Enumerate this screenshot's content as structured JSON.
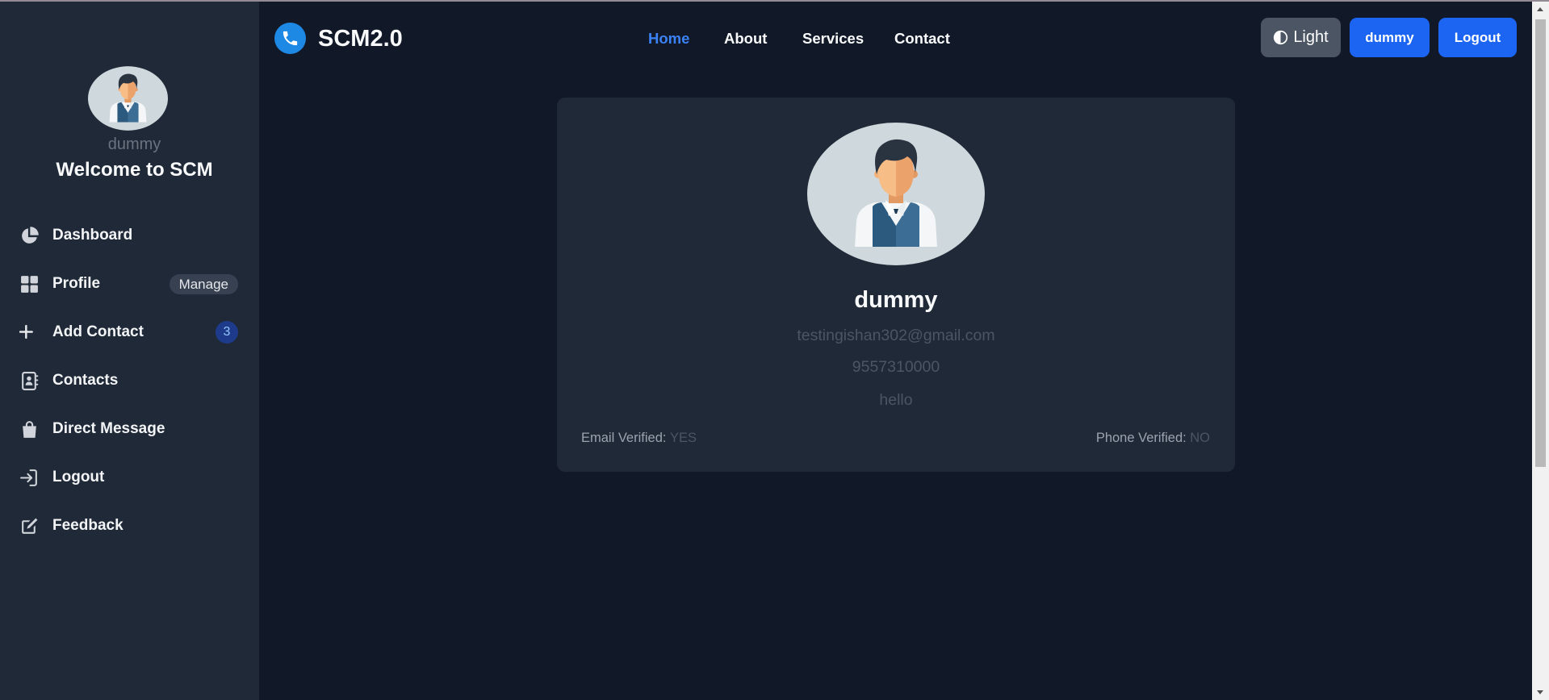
{
  "app": {
    "logo_icon": "phone-icon",
    "title": "SCM2.0"
  },
  "nav": {
    "links": [
      {
        "label": "Home",
        "active": true
      },
      {
        "label": "About",
        "active": false
      },
      {
        "label": "Services",
        "active": false
      },
      {
        "label": "Contact",
        "active": false
      }
    ],
    "theme_toggle": {
      "icon": "contrast-icon",
      "label": "Light"
    },
    "user_button": {
      "label": "dummy"
    },
    "logout_button": {
      "label": "Logout"
    }
  },
  "sidebar": {
    "avatar_icon": "user-avatar-icon",
    "username": "dummy",
    "welcome": "Welcome to SCM",
    "items": [
      {
        "icon": "pie-chart-icon",
        "label": "Dashboard"
      },
      {
        "icon": "grid-icon",
        "label": "Profile",
        "badge": "Manage"
      },
      {
        "icon": "plus-icon",
        "label": "Add Contact",
        "count": 3
      },
      {
        "icon": "address-book-icon",
        "label": "Contacts"
      },
      {
        "icon": "shopping-bag-icon",
        "label": "Direct Message"
      },
      {
        "icon": "sign-in-icon",
        "label": "Logout"
      },
      {
        "icon": "edit-icon",
        "label": "Feedback"
      }
    ]
  },
  "profile": {
    "avatar_icon": "user-avatar-icon",
    "name": "dummy",
    "email": "testingishan302@gmail.com",
    "phone": "9557310000",
    "about": "hello",
    "email_verified": {
      "label": "Email Verified:",
      "value": "YES"
    },
    "phone_verified": {
      "label": "Phone Verified:",
      "value": "NO"
    }
  },
  "colors": {
    "main_bg": "#111827",
    "sidebar_bg": "#1f2937",
    "card_bg": "#1f2937",
    "brand": "#1e88e5",
    "accent_link": "#3b82f6",
    "primary": "#1c64f2",
    "theme_button_bg": "#4b5563",
    "count_badge_bg": "#1e3a8a"
  }
}
